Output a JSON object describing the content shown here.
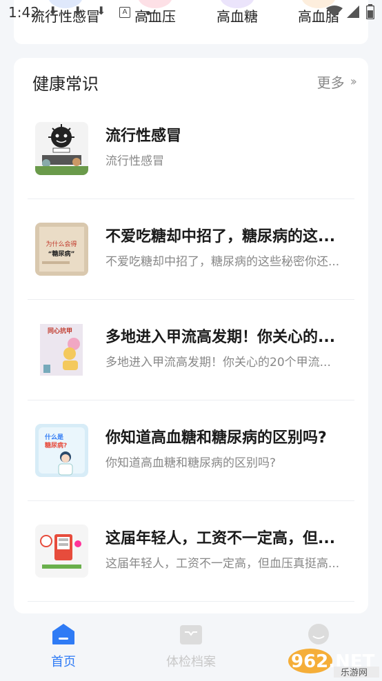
{
  "status_bar": {
    "time": "1:42"
  },
  "categories": [
    {
      "label": "流行性感冒",
      "color": "#dfe8fb"
    },
    {
      "label": "高血压",
      "color": "#fde0e6"
    },
    {
      "label": "高血糖",
      "color": "#ebe4fb"
    },
    {
      "label": "高血脂",
      "color": "#fdeedd"
    }
  ],
  "knowledge": {
    "title": "健康常识",
    "more_label": "更多",
    "items": [
      {
        "title": "流行性感冒",
        "subtitle": "流行性感冒",
        "thumb_icon": "flu-virus-illustration"
      },
      {
        "title": "不爱吃糖却中招了，糖尿病的这...",
        "subtitle": "不爱吃糖却中招了，糖尿病的这些秘密你还...",
        "thumb_icon": "diabetes-poster",
        "thumb_text1": "为什么会得",
        "thumb_text2": "“糖尿病”"
      },
      {
        "title": "多地进入甲流高发期！你关心的...",
        "subtitle": "多地进入甲流高发期！你关心的20个甲流...",
        "thumb_icon": "flu-poster",
        "thumb_text": "同心抗甲"
      },
      {
        "title": "你知道高血糖和糖尿病的区别吗?",
        "subtitle": "你知道高血糖和糖尿病的区别吗?",
        "thumb_icon": "diabetes-doctor-poster",
        "thumb_text1": "什么是",
        "thumb_text2": "糖尿病?"
      },
      {
        "title": "这届年轻人，工资不一定高，但...",
        "subtitle": "这届年轻人，工资不一定高，但血压真挺高...",
        "thumb_icon": "blood-pressure-illustration"
      }
    ]
  },
  "nav": {
    "tabs": [
      {
        "label": "首页",
        "active": true
      },
      {
        "label": "体检档案",
        "active": false
      }
    ]
  },
  "watermark": {
    "text": "962.NET",
    "sub": "乐游网"
  },
  "colors": {
    "accent": "#2f7bf5",
    "background": "#f4f6f9"
  }
}
